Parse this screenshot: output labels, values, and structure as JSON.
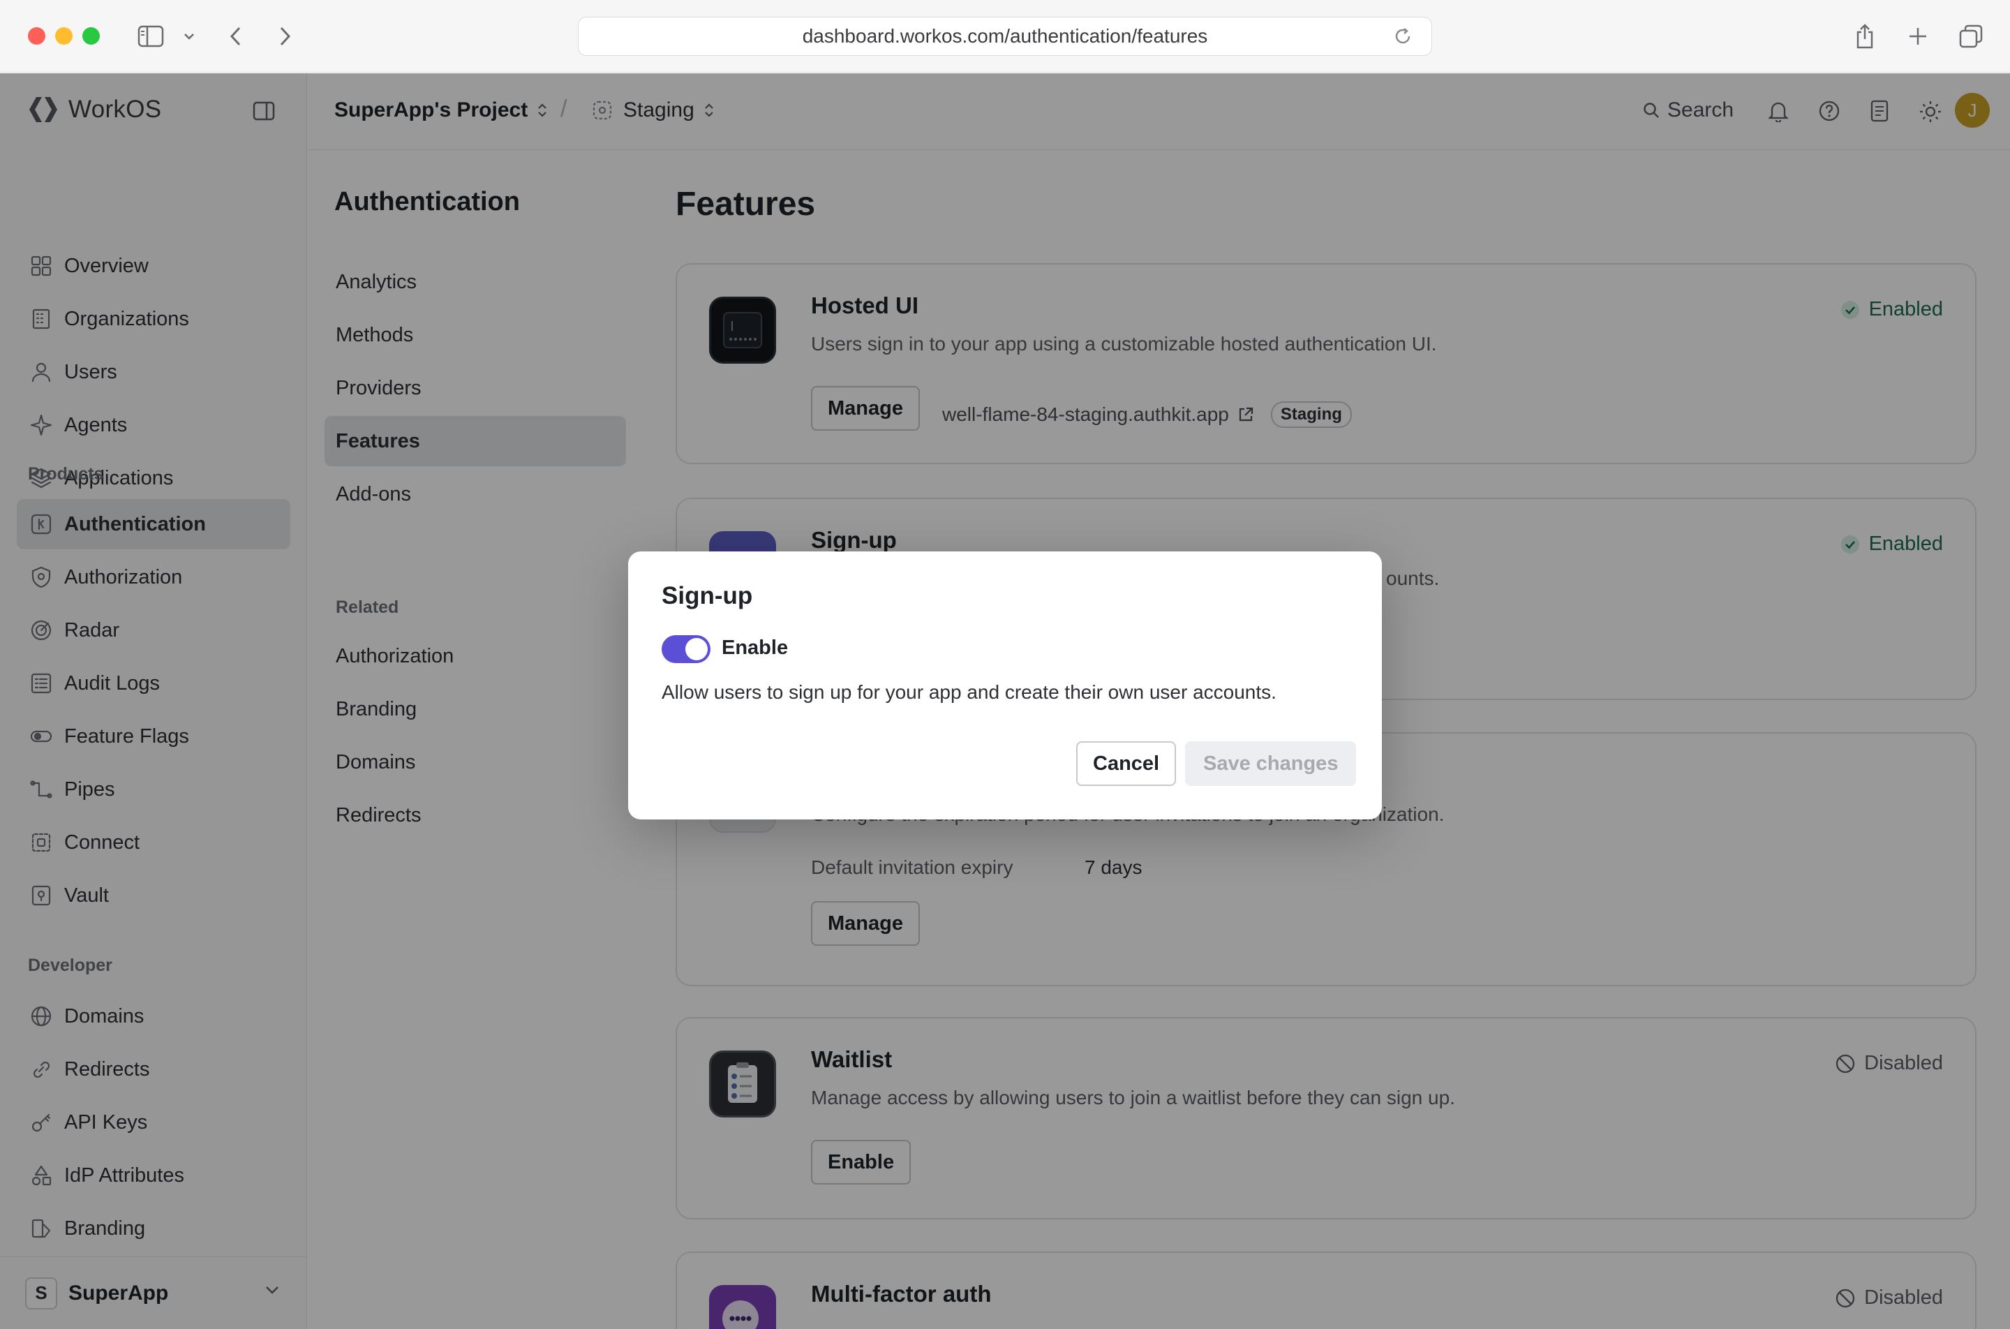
{
  "browser": {
    "url": "dashboard.workos.com/authentication/features"
  },
  "brand": {
    "name": "WorkOS",
    "accent": "#5b4fd6"
  },
  "sidebar": {
    "main_items": [
      {
        "label": "Overview",
        "icon": "grid-icon"
      },
      {
        "label": "Organizations",
        "icon": "building-icon"
      },
      {
        "label": "Users",
        "icon": "user-icon"
      },
      {
        "label": "Agents",
        "icon": "sparkle-icon"
      },
      {
        "label": "Applications",
        "icon": "layers-icon"
      }
    ],
    "products_label": "Products",
    "products": [
      {
        "label": "Authentication",
        "icon": "key-square-icon",
        "active": true
      },
      {
        "label": "Authorization",
        "icon": "shield-icon"
      },
      {
        "label": "Radar",
        "icon": "radar-icon"
      },
      {
        "label": "Audit Logs",
        "icon": "list-icon"
      },
      {
        "label": "Feature Flags",
        "icon": "toggle-icon"
      },
      {
        "label": "Pipes",
        "icon": "pipes-icon"
      },
      {
        "label": "Connect",
        "icon": "connect-icon"
      },
      {
        "label": "Vault",
        "icon": "vault-icon"
      }
    ],
    "developer_label": "Developer",
    "developer": [
      {
        "label": "Domains",
        "icon": "globe-icon"
      },
      {
        "label": "Redirects",
        "icon": "link-icon"
      },
      {
        "label": "API Keys",
        "icon": "key-icon"
      },
      {
        "label": "IdP Attributes",
        "icon": "shapes-icon"
      },
      {
        "label": "Branding",
        "icon": "brush-icon"
      }
    ],
    "workspace": {
      "initial": "S",
      "name": "SuperApp"
    }
  },
  "topbar": {
    "project": "SuperApp's Project",
    "environment": "Staging",
    "search_label": "Search",
    "avatar_initial": "J"
  },
  "subnav": {
    "title": "Authentication",
    "items": [
      "Analytics",
      "Methods",
      "Providers",
      "Features",
      "Add-ons"
    ],
    "active": "Features",
    "related_label": "Related",
    "related": [
      "Authorization",
      "Branding",
      "Domains",
      "Redirects"
    ]
  },
  "page": {
    "title": "Features",
    "cards": {
      "hosted_ui": {
        "title": "Hosted UI",
        "desc": "Users sign in to your app using a customizable hosted authentication UI.",
        "status": "Enabled",
        "button": "Manage",
        "link": "well-flame-84-staging.authkit.app",
        "badge": "Staging"
      },
      "signup": {
        "title": "Sign-up",
        "desc_visible": "ounts.",
        "status": "Enabled"
      },
      "invitations": {
        "desc_visible": "Configure the expiration period for user invitations to join an organization.",
        "expiry_label": "Default invitation expiry",
        "expiry_value": "7 days",
        "button": "Manage"
      },
      "waitlist": {
        "title": "Waitlist",
        "desc": "Manage access by allowing users to join a waitlist before they can sign up.",
        "status": "Disabled",
        "button": "Enable"
      },
      "mfa": {
        "title": "Multi-factor auth",
        "status": "Disabled"
      }
    }
  },
  "modal": {
    "title": "Sign-up",
    "toggle_label": "Enable",
    "toggle_on": true,
    "description": "Allow users to sign up for your app and create their own user accounts.",
    "cancel": "Cancel",
    "save": "Save changes"
  }
}
